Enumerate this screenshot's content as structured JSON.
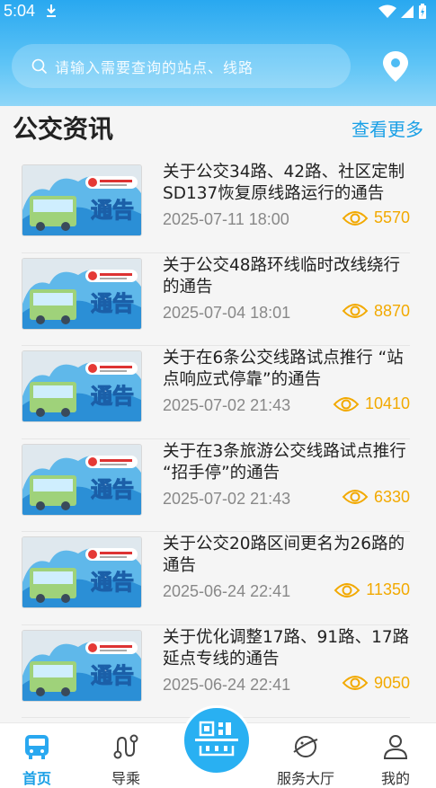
{
  "status_bar": {
    "time": "5:04"
  },
  "search": {
    "placeholder": "请输入需要查询的站点、线路"
  },
  "news_section": {
    "title": "公交资讯",
    "more_label": "查看更多"
  },
  "news": [
    {
      "title": "关于公交34路、42路、社区定制SD137恢复原线路运行的通告",
      "date": "2025-07-11 18:00",
      "views": "5570",
      "thumb_text": "通告"
    },
    {
      "title": "关于公交48路环线临时改线绕行的通告",
      "date": "2025-07-04 18:01",
      "views": "8870",
      "thumb_text": "通告"
    },
    {
      "title": "关于在6条公交线路试点推行 “站点响应式停靠”的通告",
      "date": "2025-07-02 21:43",
      "views": "10410",
      "thumb_text": "通告"
    },
    {
      "title": "关于在3条旅游公交线路试点推行 “招手停”的通告",
      "date": "2025-07-02 21:43",
      "views": "6330",
      "thumb_text": "通告"
    },
    {
      "title": "关于公交20路区间更名为26路的通告",
      "date": "2025-06-24 22:41",
      "views": "11350",
      "thumb_text": "通告"
    },
    {
      "title": "关于优化调整17路、91路、17路延点专线的通告",
      "date": "2025-06-24 22:41",
      "views": "9050",
      "thumb_text": "通告"
    }
  ],
  "tabbar": {
    "home": "首页",
    "guide": "导乘",
    "service": "服务大厅",
    "mine": "我的"
  },
  "colors": {
    "accent": "#1aa0e6",
    "views": "#f2a900",
    "header": "#29a8f0"
  }
}
